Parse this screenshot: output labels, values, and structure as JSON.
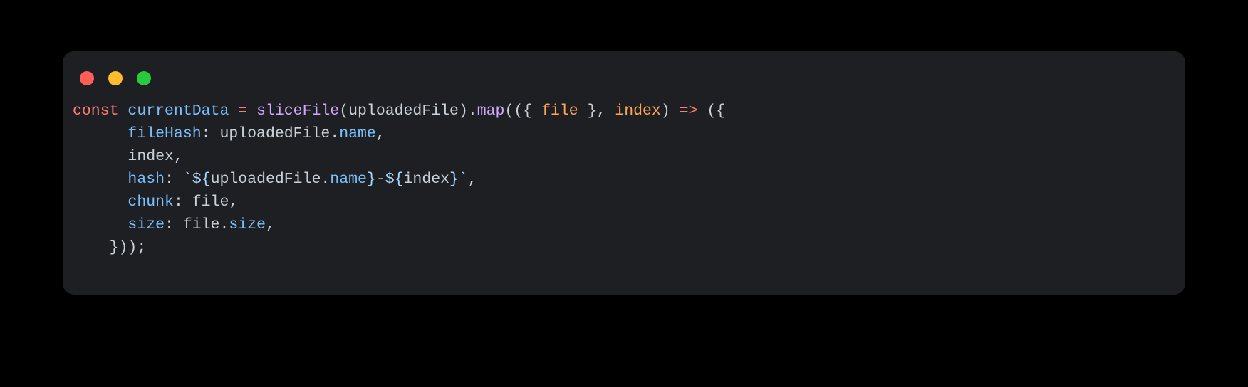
{
  "window": {
    "colors": {
      "red": "#ff5f56",
      "yellow": "#ffbd2e",
      "green": "#27c93f",
      "background": "#1e1f22"
    }
  },
  "code": {
    "language": "javascript",
    "plain_text": "const currentData = sliceFile(uploadedFile).map(({ file }, index) => ({\n      fileHash: uploadedFile.name,\n      index,\n      hash: `${uploadedFile.name}-${index}`,\n      chunk: file,\n      size: file.size,\n    }));",
    "tokens": [
      [
        {
          "t": "keyword",
          "v": "const"
        },
        {
          "t": "plain",
          "v": " "
        },
        {
          "t": "var",
          "v": "currentData"
        },
        {
          "t": "plain",
          "v": " "
        },
        {
          "t": "operator",
          "v": "="
        },
        {
          "t": "plain",
          "v": " "
        },
        {
          "t": "func",
          "v": "sliceFile"
        },
        {
          "t": "punct",
          "v": "("
        },
        {
          "t": "plain",
          "v": "uploadedFile"
        },
        {
          "t": "punct",
          "v": ")."
        },
        {
          "t": "func",
          "v": "map"
        },
        {
          "t": "punct",
          "v": "(({ "
        },
        {
          "t": "param",
          "v": "file"
        },
        {
          "t": "punct",
          "v": " }, "
        },
        {
          "t": "param",
          "v": "index"
        },
        {
          "t": "punct",
          "v": ") "
        },
        {
          "t": "arrow",
          "v": "=>"
        },
        {
          "t": "punct",
          "v": " ({"
        }
      ],
      [
        {
          "t": "plain",
          "v": "      "
        },
        {
          "t": "prop",
          "v": "fileHash"
        },
        {
          "t": "punct",
          "v": ": uploadedFile."
        },
        {
          "t": "prop",
          "v": "name"
        },
        {
          "t": "punct",
          "v": ","
        }
      ],
      [
        {
          "t": "plain",
          "v": "      "
        },
        {
          "t": "plain",
          "v": "index"
        },
        {
          "t": "punct",
          "v": ","
        }
      ],
      [
        {
          "t": "plain",
          "v": "      "
        },
        {
          "t": "prop",
          "v": "hash"
        },
        {
          "t": "punct",
          "v": ": "
        },
        {
          "t": "string",
          "v": "`"
        },
        {
          "t": "templ-punct",
          "v": "${"
        },
        {
          "t": "plain",
          "v": "uploadedFile"
        },
        {
          "t": "punct",
          "v": "."
        },
        {
          "t": "prop",
          "v": "name"
        },
        {
          "t": "templ-punct",
          "v": "}"
        },
        {
          "t": "string",
          "v": "-"
        },
        {
          "t": "templ-punct",
          "v": "${"
        },
        {
          "t": "plain",
          "v": "index"
        },
        {
          "t": "templ-punct",
          "v": "}"
        },
        {
          "t": "string",
          "v": "`"
        },
        {
          "t": "punct",
          "v": ","
        }
      ],
      [
        {
          "t": "plain",
          "v": "      "
        },
        {
          "t": "prop",
          "v": "chunk"
        },
        {
          "t": "punct",
          "v": ": file,"
        }
      ],
      [
        {
          "t": "plain",
          "v": "      "
        },
        {
          "t": "prop",
          "v": "size"
        },
        {
          "t": "punct",
          "v": ": file."
        },
        {
          "t": "prop",
          "v": "size"
        },
        {
          "t": "punct",
          "v": ","
        }
      ],
      [
        {
          "t": "plain",
          "v": "    "
        },
        {
          "t": "punct",
          "v": "}));"
        }
      ]
    ]
  }
}
